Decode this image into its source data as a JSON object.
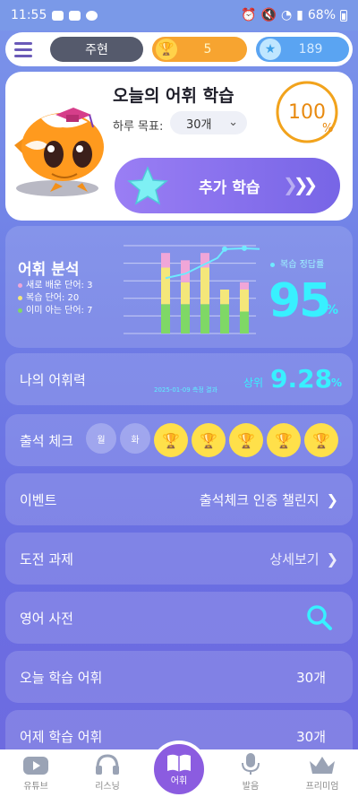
{
  "status_bar": {
    "time": "11:55",
    "battery": "68%"
  },
  "top_bar": {
    "user_name": "주현",
    "trophies": "5",
    "stars": "189"
  },
  "hero": {
    "title": "오늘의 어휘 학습",
    "goal_label": "하루 목표:",
    "goal_value": "30개",
    "progress": "100",
    "progress_unit": "%",
    "progress_fraction": 1.0,
    "extra_button": "추가 학습"
  },
  "analysis": {
    "title": "어휘 분석",
    "legend": [
      {
        "label": "새로 배운 단어: 3",
        "color": "#f0a6d8"
      },
      {
        "label": "복습 단어: 20",
        "color": "#f4e77a"
      },
      {
        "label": "이미 아는 단어: 7",
        "color": "#7fd866"
      }
    ],
    "accuracy_label": "복습 정답률",
    "accuracy_value": "95",
    "accuracy_unit": "%"
  },
  "chart_data": {
    "type": "bar",
    "series": [
      {
        "values": [
          4,
          4,
          4,
          4,
          3,
          3
        ]
      },
      {
        "values": [
          5,
          3,
          5,
          2,
          3,
          4
        ]
      },
      {
        "values": [
          2,
          3,
          2,
          0,
          1,
          1
        ]
      }
    ],
    "line": [
      0.63,
      0.68,
      0.86,
      0.96,
      0.97,
      0.96
    ],
    "colors": [
      "#7fd866",
      "#f4e77a",
      "#f0a6d8",
      "#6eeaff"
    ]
  },
  "vocab_power": {
    "label": "나의 어휘력",
    "date": "2025-01-09 측정 결과",
    "rank_label": "상위",
    "rank_value": "9.28",
    "rank_unit": "%"
  },
  "attendance": {
    "label": "출석 체크",
    "days": [
      "월",
      "화"
    ]
  },
  "event": {
    "label": "이벤트",
    "value": "출석체크 인증 챌린지"
  },
  "challenge": {
    "label": "도전 과제",
    "value": "상세보기"
  },
  "dictionary": {
    "label": "영어 사전"
  },
  "today_words": {
    "label": "오늘 학습 어휘",
    "value": "30개"
  },
  "yesterday_words": {
    "label": "어제 학습 어휘",
    "value": "30개"
  },
  "nav": {
    "youtube": "유튜브",
    "listening": "리스닝",
    "vocab": "어휘",
    "pronunciation": "발음",
    "premium": "프리미엄"
  }
}
